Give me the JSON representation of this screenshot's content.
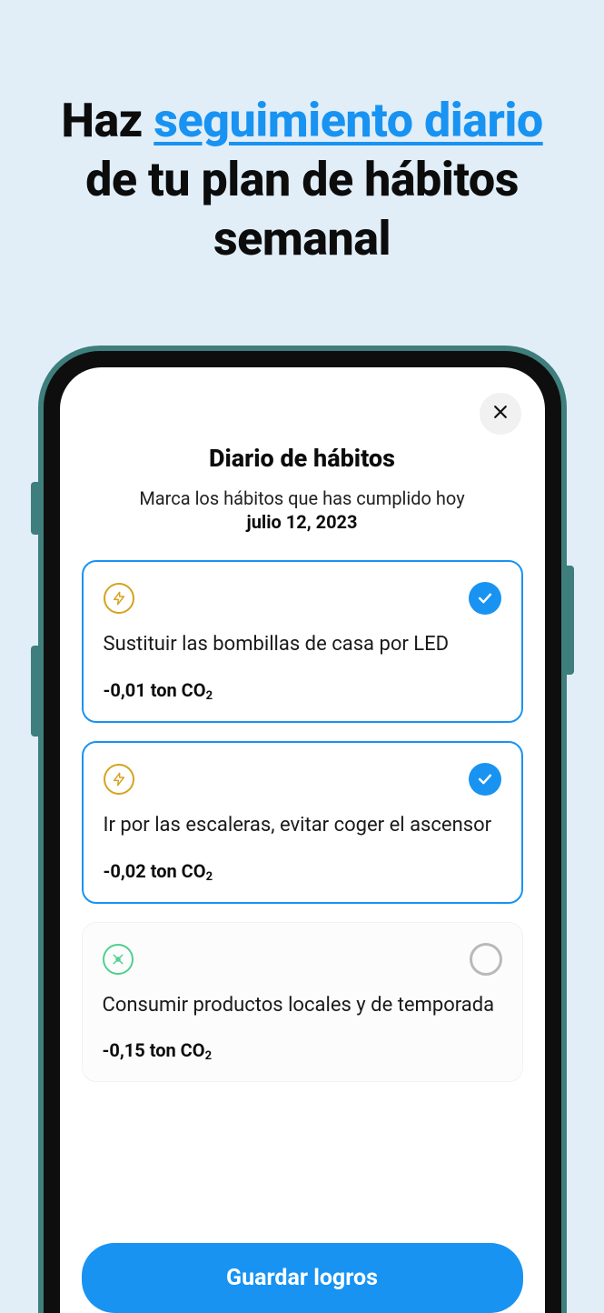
{
  "promo": {
    "pre": "Haz ",
    "highlight": "seguimiento diario",
    "post": " de tu plan de hábitos semanal"
  },
  "modal": {
    "title": "Diario de hábitos",
    "subtitle": "Marca los hábitos que has cumplido hoy",
    "date": "julio 12, 2023",
    "cta": "Guardar logros"
  },
  "habits": [
    {
      "category": "energy",
      "selected": true,
      "title": "Sustituir las bombillas de casa por LED",
      "metric_value": "-0,01",
      "metric_unit_prefix": " ton CO",
      "metric_unit_sub": "2"
    },
    {
      "category": "energy",
      "selected": true,
      "title": "Ir por las escaleras, evitar coger el ascensor",
      "metric_value": "-0,02",
      "metric_unit_prefix": " ton CO",
      "metric_unit_sub": "2"
    },
    {
      "category": "food",
      "selected": false,
      "title": "Consumir productos locales y de temporada",
      "metric_value": "-0,15",
      "metric_unit_prefix": " ton CO",
      "metric_unit_sub": "2"
    }
  ]
}
